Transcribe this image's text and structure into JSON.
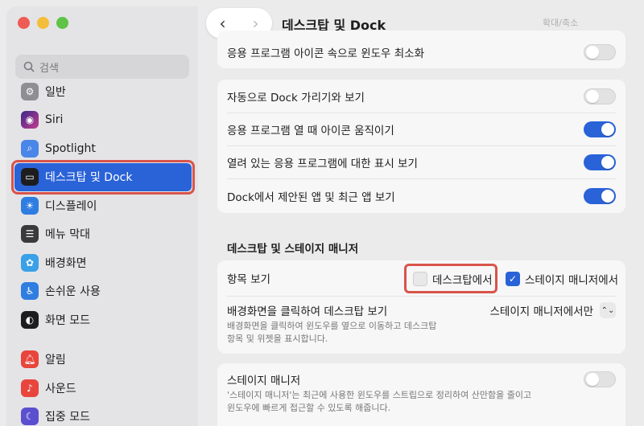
{
  "sidebar": {
    "search_placeholder": "검색",
    "items": [
      {
        "label": "일반",
        "icon": "gear-icon",
        "color": "#8e8e93"
      },
      {
        "label": "Siri",
        "icon": "siri-icon",
        "color": "#7a3fc9"
      },
      {
        "label": "Spotlight",
        "icon": "spotlight-icon",
        "color": "#4a86e8"
      },
      {
        "label": "데스크탑 및 Dock",
        "icon": "dock-icon",
        "color": "#1d1d1f"
      },
      {
        "label": "디스플레이",
        "icon": "display-icon",
        "color": "#2f7de1"
      },
      {
        "label": "메뉴 막대",
        "icon": "menubar-icon",
        "color": "#3a3a3c"
      },
      {
        "label": "배경화면",
        "icon": "wallpaper-icon",
        "color": "#3aa0e8"
      },
      {
        "label": "손쉬운 사용",
        "icon": "accessibility-icon",
        "color": "#2f7de1"
      },
      {
        "label": "화면 모드",
        "icon": "appearance-icon",
        "color": "#1d1d1f"
      },
      {
        "label": "알림",
        "icon": "notifications-icon",
        "color": "#e8453c"
      },
      {
        "label": "사운드",
        "icon": "sound-icon",
        "color": "#e8453c"
      },
      {
        "label": "집중 모드",
        "icon": "focus-icon",
        "color": "#5a4fcf"
      }
    ]
  },
  "header": {
    "title": "데스크탑 및 Dock",
    "right_text": "확대/축소"
  },
  "rows": {
    "minimize_into_icon": "응용 프로그램 아이콘 속으로 윈도우 최소화",
    "autohide": "자동으로 Dock 가리기와 보기",
    "animate": "응용 프로그램 열 때 아이콘 움직이기",
    "indicators": "열려 있는 응용 프로그램에 대한 표시 보기",
    "recent_apps": "Dock에서 제안된 앱 및 최근 앱 보기"
  },
  "stage": {
    "section_title": "데스크탑 및 스테이지 매니저",
    "show_items_label": "항목 보기",
    "on_desktop_label": "데스크탑에서",
    "in_stage_label": "스테이지 매니저에서",
    "click_wallpaper_label": "배경화면을 클릭하여 데스크탑 보기",
    "click_wallpaper_desc_1": "배경화면을 클릭하여 윈도우를 옆으로 이동하고 데스크탑",
    "click_wallpaper_desc_2": "항목 및 위젯을 표시합니다.",
    "click_wallpaper_value": "스테이지 매니저에서만",
    "stage_manager_label": "스테이지 매니저",
    "stage_manager_desc_1": "'스테이지 매니저'는 최근에 사용한 윈도우를 스트립으로 정리하여 산만함을 줄이고",
    "stage_manager_desc_2": "윈도우에 빠르게 접근할 수 있도록 해줍니다."
  }
}
